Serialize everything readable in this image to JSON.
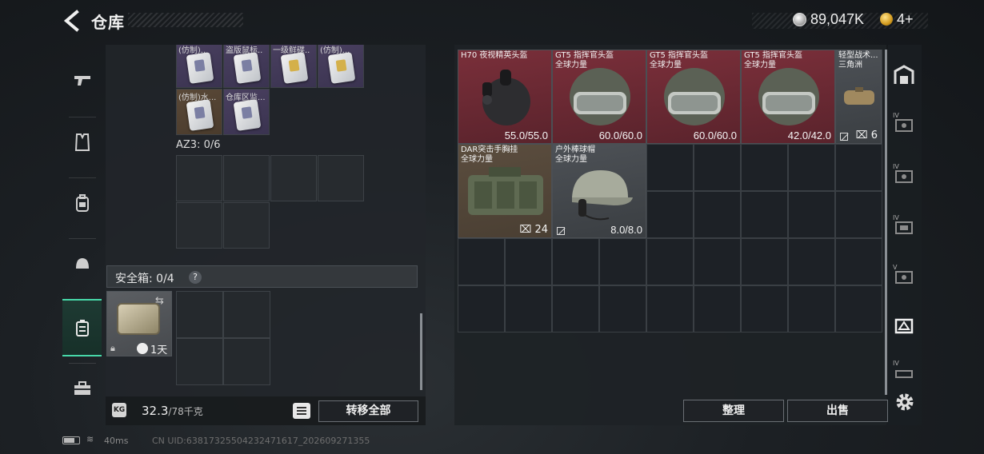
{
  "header": {
    "title": "仓库",
    "coin_value": "89,047K",
    "token_value": "4+"
  },
  "side_tabs": [
    {
      "name": "weapon",
      "icon": "gun-icon"
    },
    {
      "name": "vest",
      "icon": "vest-icon"
    },
    {
      "name": "backpack",
      "icon": "backpack-icon"
    },
    {
      "name": "helmet",
      "icon": "helmet-icon"
    },
    {
      "name": "container",
      "icon": "container-icon",
      "active": true
    },
    {
      "name": "toolbox",
      "icon": "toolbox-icon"
    }
  ],
  "storage": {
    "top_labels": [
      "(仿制)..",
      "盗版鼠标..",
      "一级鲜碟..",
      "(仿制)..."
    ],
    "row2_labels": [
      "(仿制)水...",
      "仓库区监..."
    ],
    "az3_label": "AZ3: 0/6",
    "safe_label": "安全箱: 0/4",
    "safe_help": "?",
    "safe_time": "1天"
  },
  "bottom": {
    "weight_icon_text": "KG",
    "weight": "32.3",
    "weight_max": "/78千克",
    "transfer_all": "转移全部"
  },
  "items": [
    {
      "name": "H70 夜视精英头盔",
      "sub": "",
      "durability": "55.0/55.0"
    },
    {
      "name": "GT5 指挥官头盔",
      "sub": "全球力量",
      "durability": "60.0/60.0"
    },
    {
      "name": "GT5 指挥官头盔",
      "sub": "全球力量",
      "durability": "60.0/60.0"
    },
    {
      "name": "GT5 指挥官头盔",
      "sub": "全球力量",
      "durability": "42.0/42.0"
    },
    {
      "name": "轻型战术...",
      "sub": "三角洲",
      "count": "6"
    },
    {
      "name": "DAR突击手胸挂",
      "sub": "全球力量",
      "count": "24"
    },
    {
      "name": "户外棒球帽",
      "sub": "全球力量",
      "durability": "8.0/8.0"
    }
  ],
  "actions": {
    "sort": "整理",
    "sell": "出售"
  },
  "right_column": {
    "levels": [
      "IV",
      "IV",
      "IV",
      "V",
      "IV"
    ]
  },
  "status_bar": {
    "ping": "40ms",
    "uid": "CN UID:6381732550423247161​7_202609271355"
  },
  "colors": {
    "accent": "#47d8a9",
    "red_item": "#7a2f3a"
  }
}
